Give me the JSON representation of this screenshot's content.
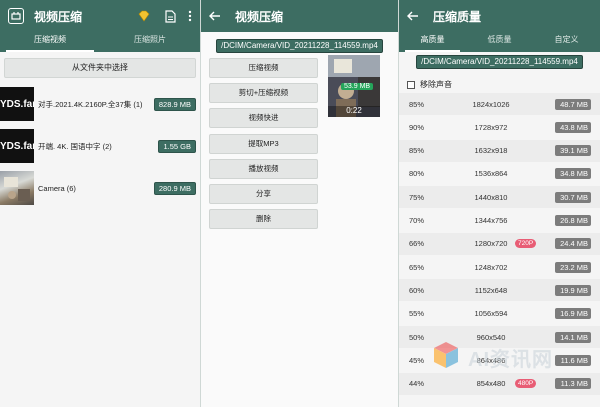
{
  "left": {
    "title": "视频压缩",
    "tabs": [
      "压缩视频",
      "压缩照片"
    ],
    "select_button": "从文件夹中选择",
    "folders": [
      {
        "thumb": "YDS.fan",
        "name": "对手.2021.4K.2160P.全37集 (1)",
        "size": "828.9 MB"
      },
      {
        "thumb": "YDS.fan",
        "name": "开端. 4K. 国语中字 (2)",
        "size": "1.55 GB"
      },
      {
        "thumb": "",
        "name": "Camera (6)",
        "size": "280.9 MB"
      }
    ]
  },
  "middle": {
    "title": "视频压缩",
    "path": "/DCIM/Camera/VID_20211228_114559.mp4",
    "actions": [
      "压缩视频",
      "剪切+压缩视频",
      "视频快进",
      "提取MP3",
      "播放视频",
      "分享",
      "删除"
    ],
    "video_size": "53.9 MB",
    "video_duration": "0:22"
  },
  "right": {
    "title": "压缩质量",
    "tabs": [
      "高质量",
      "低质量",
      "自定义"
    ],
    "path": "/DCIM/Camera/VID_20211228_114559.mp4",
    "remove_audio_label": "移除声音",
    "rows": [
      {
        "pct": "85%",
        "res": "1824x1026",
        "size": "48.7 MB",
        "hint": ""
      },
      {
        "pct": "90%",
        "res": "1728x972",
        "size": "43.8 MB",
        "hint": ""
      },
      {
        "pct": "85%",
        "res": "1632x918",
        "size": "39.1 MB",
        "hint": ""
      },
      {
        "pct": "80%",
        "res": "1536x864",
        "size": "34.8 MB",
        "hint": ""
      },
      {
        "pct": "75%",
        "res": "1440x810",
        "size": "30.7 MB",
        "hint": ""
      },
      {
        "pct": "70%",
        "res": "1344x756",
        "size": "26.8 MB",
        "hint": ""
      },
      {
        "pct": "66%",
        "res": "1280x720",
        "size": "24.4 MB",
        "hint": "720P"
      },
      {
        "pct": "65%",
        "res": "1248x702",
        "size": "23.2 MB",
        "hint": ""
      },
      {
        "pct": "60%",
        "res": "1152x648",
        "size": "19.9 MB",
        "hint": ""
      },
      {
        "pct": "55%",
        "res": "1056x594",
        "size": "16.9 MB",
        "hint": ""
      },
      {
        "pct": "50%",
        "res": "960x540",
        "size": "14.1 MB",
        "hint": ""
      },
      {
        "pct": "45%",
        "res": "864x486",
        "size": "11.6 MB",
        "hint": ""
      },
      {
        "pct": "44%",
        "res": "854x480",
        "size": "11.3 MB",
        "hint": "480P"
      }
    ]
  },
  "watermark": "AI资讯网"
}
